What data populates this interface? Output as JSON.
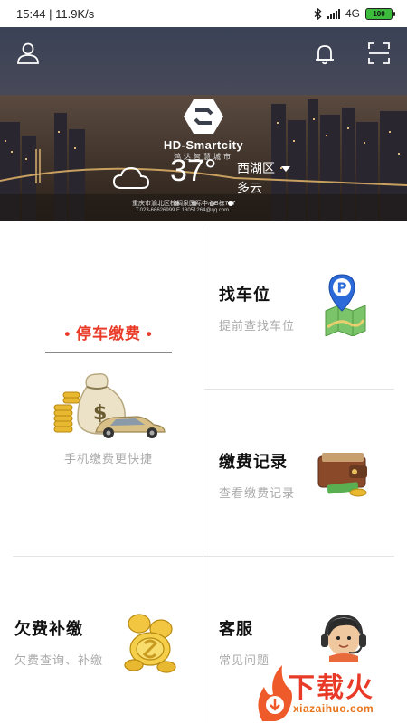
{
  "status_bar": {
    "time": "15:44",
    "speed": "11.9K/s",
    "network": "4G",
    "battery": "100"
  },
  "header": {
    "icons": [
      "user-icon",
      "bell-icon",
      "scan-icon"
    ]
  },
  "banner": {
    "logo_name": "HD-Smartcity",
    "logo_subtitle": "鸿达智慧城市",
    "temperature": "37°",
    "district": "西湖区",
    "condition": "多云",
    "address": "重庆市渝北区棕榈泉国际中心B栋707",
    "contact": "T.023-66626999  E.18051264@qq.com",
    "slide_count": 4,
    "active_slide": 4
  },
  "menu": {
    "parking_payment": {
      "title": "停车缴费",
      "subtitle": "手机缴费更快捷"
    },
    "find_spot": {
      "title": "找车位",
      "subtitle": "提前查找车位"
    },
    "payment_records": {
      "title": "缴费记录",
      "subtitle": "查看缴费记录"
    },
    "arrears": {
      "title": "欠费补缴",
      "subtitle": "欠费查询、补缴"
    },
    "service": {
      "title": "客服",
      "subtitle": "常见问题"
    }
  },
  "watermark": {
    "text": "下载火",
    "url": "xiazaihuo.com"
  },
  "colors": {
    "accent": "#e83a26",
    "watermark_orange": "#e8731a",
    "divider": "#e4e4e4"
  }
}
